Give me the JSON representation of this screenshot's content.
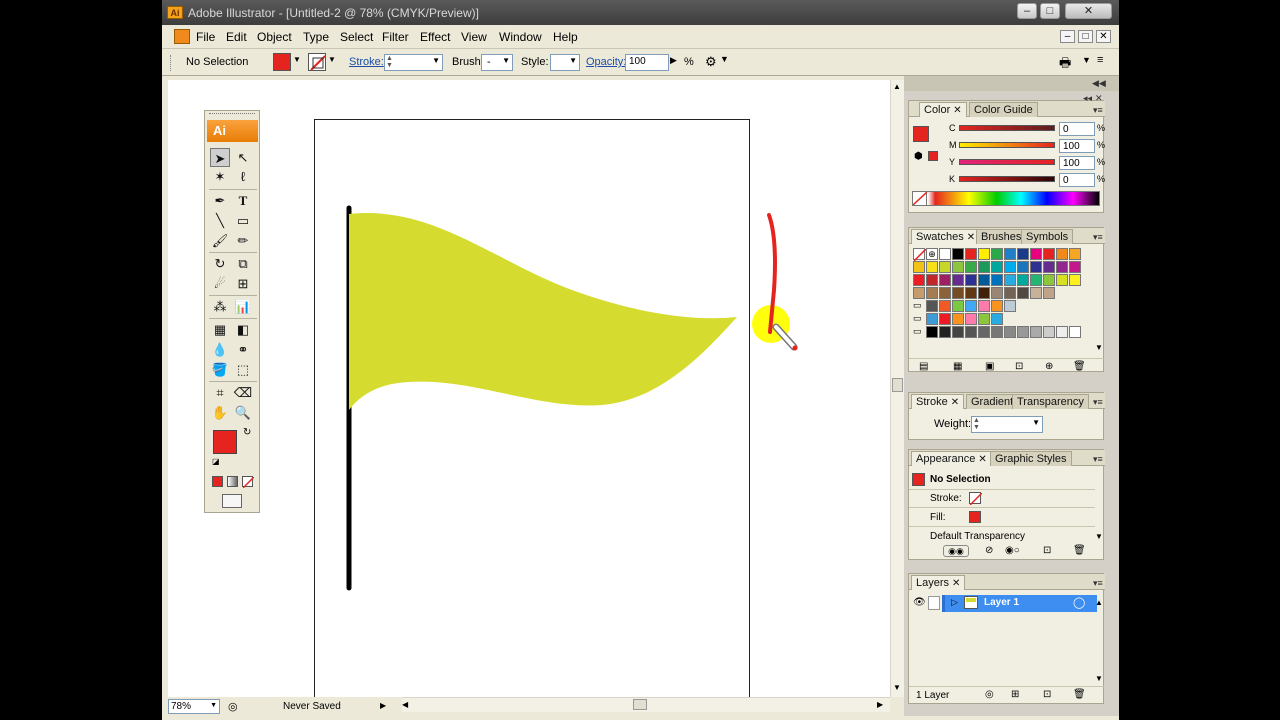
{
  "window": {
    "title": "Adobe Illustrator - [Untitled-2 @ 78% (CMYK/Preview)]",
    "app_icon": "Ai",
    "controls": [
      "–",
      "□",
      "✕"
    ]
  },
  "menu": [
    "File",
    "Edit",
    "Object",
    "Type",
    "Select",
    "Filter",
    "Effect",
    "View",
    "Window",
    "Help"
  ],
  "mdi_controls": [
    "–",
    "□",
    "✕"
  ],
  "control_bar": {
    "selection": "No Selection",
    "stroke_label": "Stroke:",
    "brush_label": "Brush:",
    "brush_value": "-",
    "style_label": "Style:",
    "opacity_label": "Opacity:",
    "opacity_value": "100",
    "opacity_unit": "%"
  },
  "tools": {
    "header": "Ai"
  },
  "colors": {
    "flag": "#d6dc2f",
    "fill": "#e52420",
    "pen_stroke": "#e52420",
    "highlight": "#ffff00",
    "pole": "#000000",
    "layer_highlight": "#3d8ef0",
    "ai_orange": "#f08a1d"
  },
  "panels": {
    "color": {
      "tabs": [
        "Color",
        "Color Guide"
      ],
      "channels": [
        {
          "label": "C",
          "value": "0",
          "unit": "%"
        },
        {
          "label": "M",
          "value": "100",
          "unit": "%"
        },
        {
          "label": "Y",
          "value": "100",
          "unit": "%"
        },
        {
          "label": "K",
          "value": "0",
          "unit": "%"
        }
      ]
    },
    "swatches": {
      "tabs": [
        "Swatches",
        "Brushes",
        "Symbols"
      ]
    },
    "stroke": {
      "tabs": [
        "Stroke",
        "Gradient",
        "Transparency"
      ],
      "weight_label": "Weight:"
    },
    "appearance": {
      "tabs": [
        "Appearance",
        "Graphic Styles"
      ],
      "title": "No Selection",
      "stroke_label": "Stroke:",
      "fill_label": "Fill:",
      "transparency": "Default Transparency"
    },
    "layers": {
      "tabs": [
        "Layers"
      ],
      "layer_name": "Layer 1",
      "count": "1 Layer"
    }
  },
  "status_bar": {
    "zoom": "78%",
    "status": "Never Saved"
  }
}
